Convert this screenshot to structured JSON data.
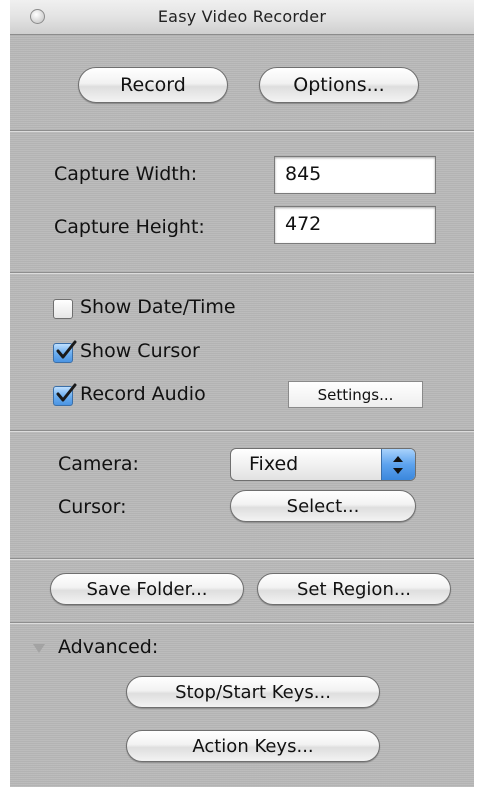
{
  "window": {
    "title": "Easy Video Recorder"
  },
  "top_buttons": {
    "record": "Record",
    "options": "Options..."
  },
  "capture": {
    "width_label": "Capture Width:",
    "width_value": "845",
    "height_label": "Capture Height:",
    "height_value": "472"
  },
  "checks": {
    "show_datetime": {
      "label": "Show Date/Time",
      "checked": false
    },
    "show_cursor": {
      "label": "Show Cursor",
      "checked": true
    },
    "record_audio": {
      "label": "Record Audio",
      "checked": true
    },
    "audio_settings": "Settings..."
  },
  "camera": {
    "label": "Camera:",
    "selected": "Fixed"
  },
  "cursor": {
    "label": "Cursor:",
    "button": "Select..."
  },
  "folder_region": {
    "save_folder": "Save Folder...",
    "set_region": "Set Region..."
  },
  "advanced": {
    "label": "Advanced:",
    "stop_start_keys": "Stop/Start Keys...",
    "action_keys": "Action Keys..."
  },
  "colors": {
    "checkbox_checked": "#4b94e3",
    "window_bg": "#b9b9b9"
  },
  "icons": [
    "close-icon",
    "checkmark-icon",
    "popup-arrows-icon",
    "disclosure-triangle-icon"
  ]
}
